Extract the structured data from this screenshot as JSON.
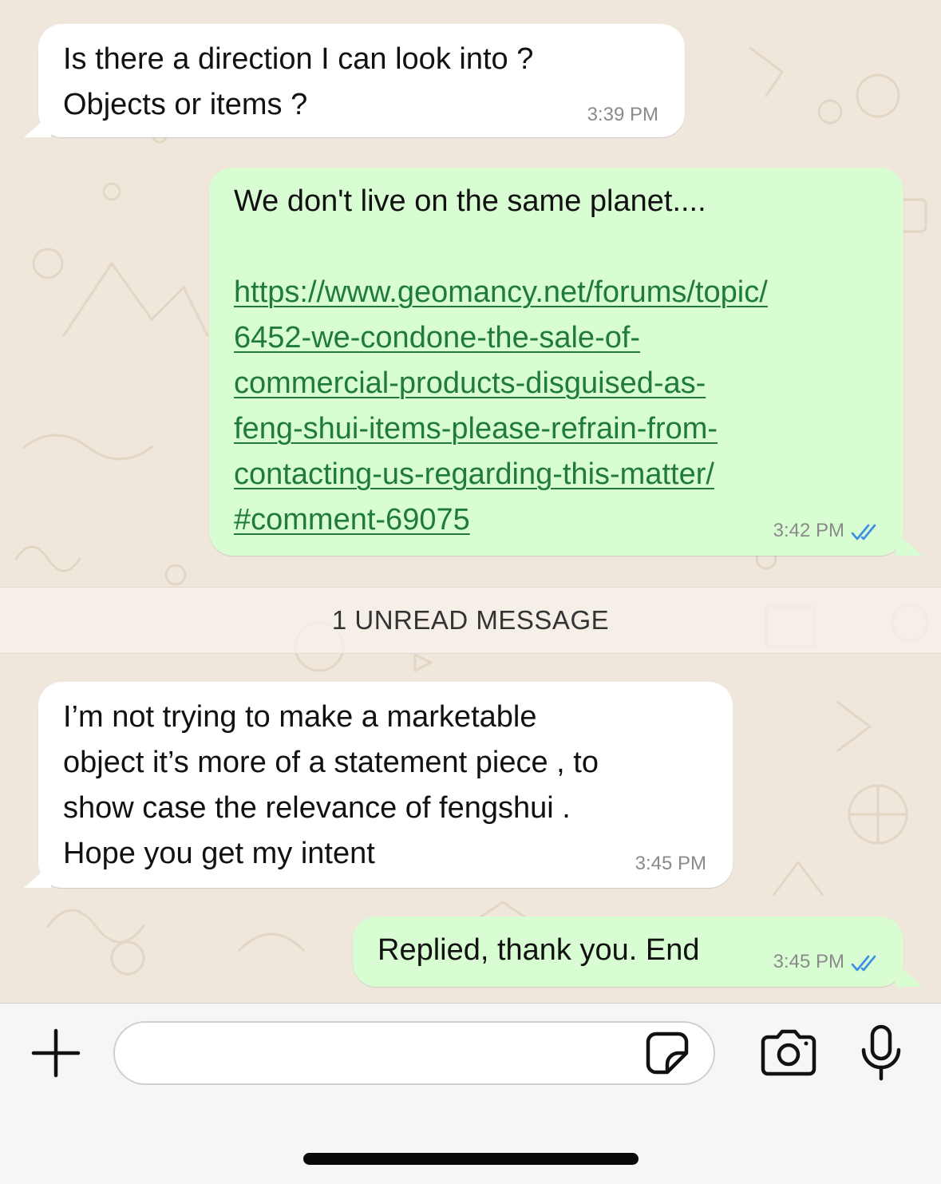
{
  "messages": [
    {
      "direction": "incoming",
      "lines": [
        "Is there a direction I can look into ?",
        "Objects or items ?"
      ],
      "time": "3:39 PM"
    },
    {
      "direction": "outgoing",
      "text": "We don't live on the same planet....",
      "link_lines": [
        "https://www.geomancy.net/forums/topic/",
        "6452-we-condone-the-sale-of-",
        "commercial-products-disguised-as-",
        "feng-shui-items-please-refrain-from-",
        "contacting-us-regarding-this-matter/",
        "#comment-69075"
      ],
      "time": "3:42 PM",
      "status": "read"
    },
    {
      "direction": "incoming",
      "lines": [
        "I’m not trying to make a marketable",
        "object it’s more of a statement piece , to",
        "show case the relevance of fengshui .",
        "Hope you get my intent"
      ],
      "time": "3:45 PM"
    },
    {
      "direction": "outgoing",
      "text": "Replied, thank you. End",
      "time": "3:45 PM",
      "status": "read"
    }
  ],
  "unread_divider": "1 UNREAD MESSAGE",
  "composer": {
    "placeholder": "",
    "icons": [
      "plus-icon",
      "sticker-icon",
      "camera-icon",
      "microphone-icon"
    ]
  },
  "colors": {
    "incoming_bubble": "#ffffff",
    "outgoing_bubble": "#d9fdd3",
    "link": "#1f7a3c",
    "read_ticks": "#3a8ee6",
    "wallpaper": "#efe7dc"
  }
}
